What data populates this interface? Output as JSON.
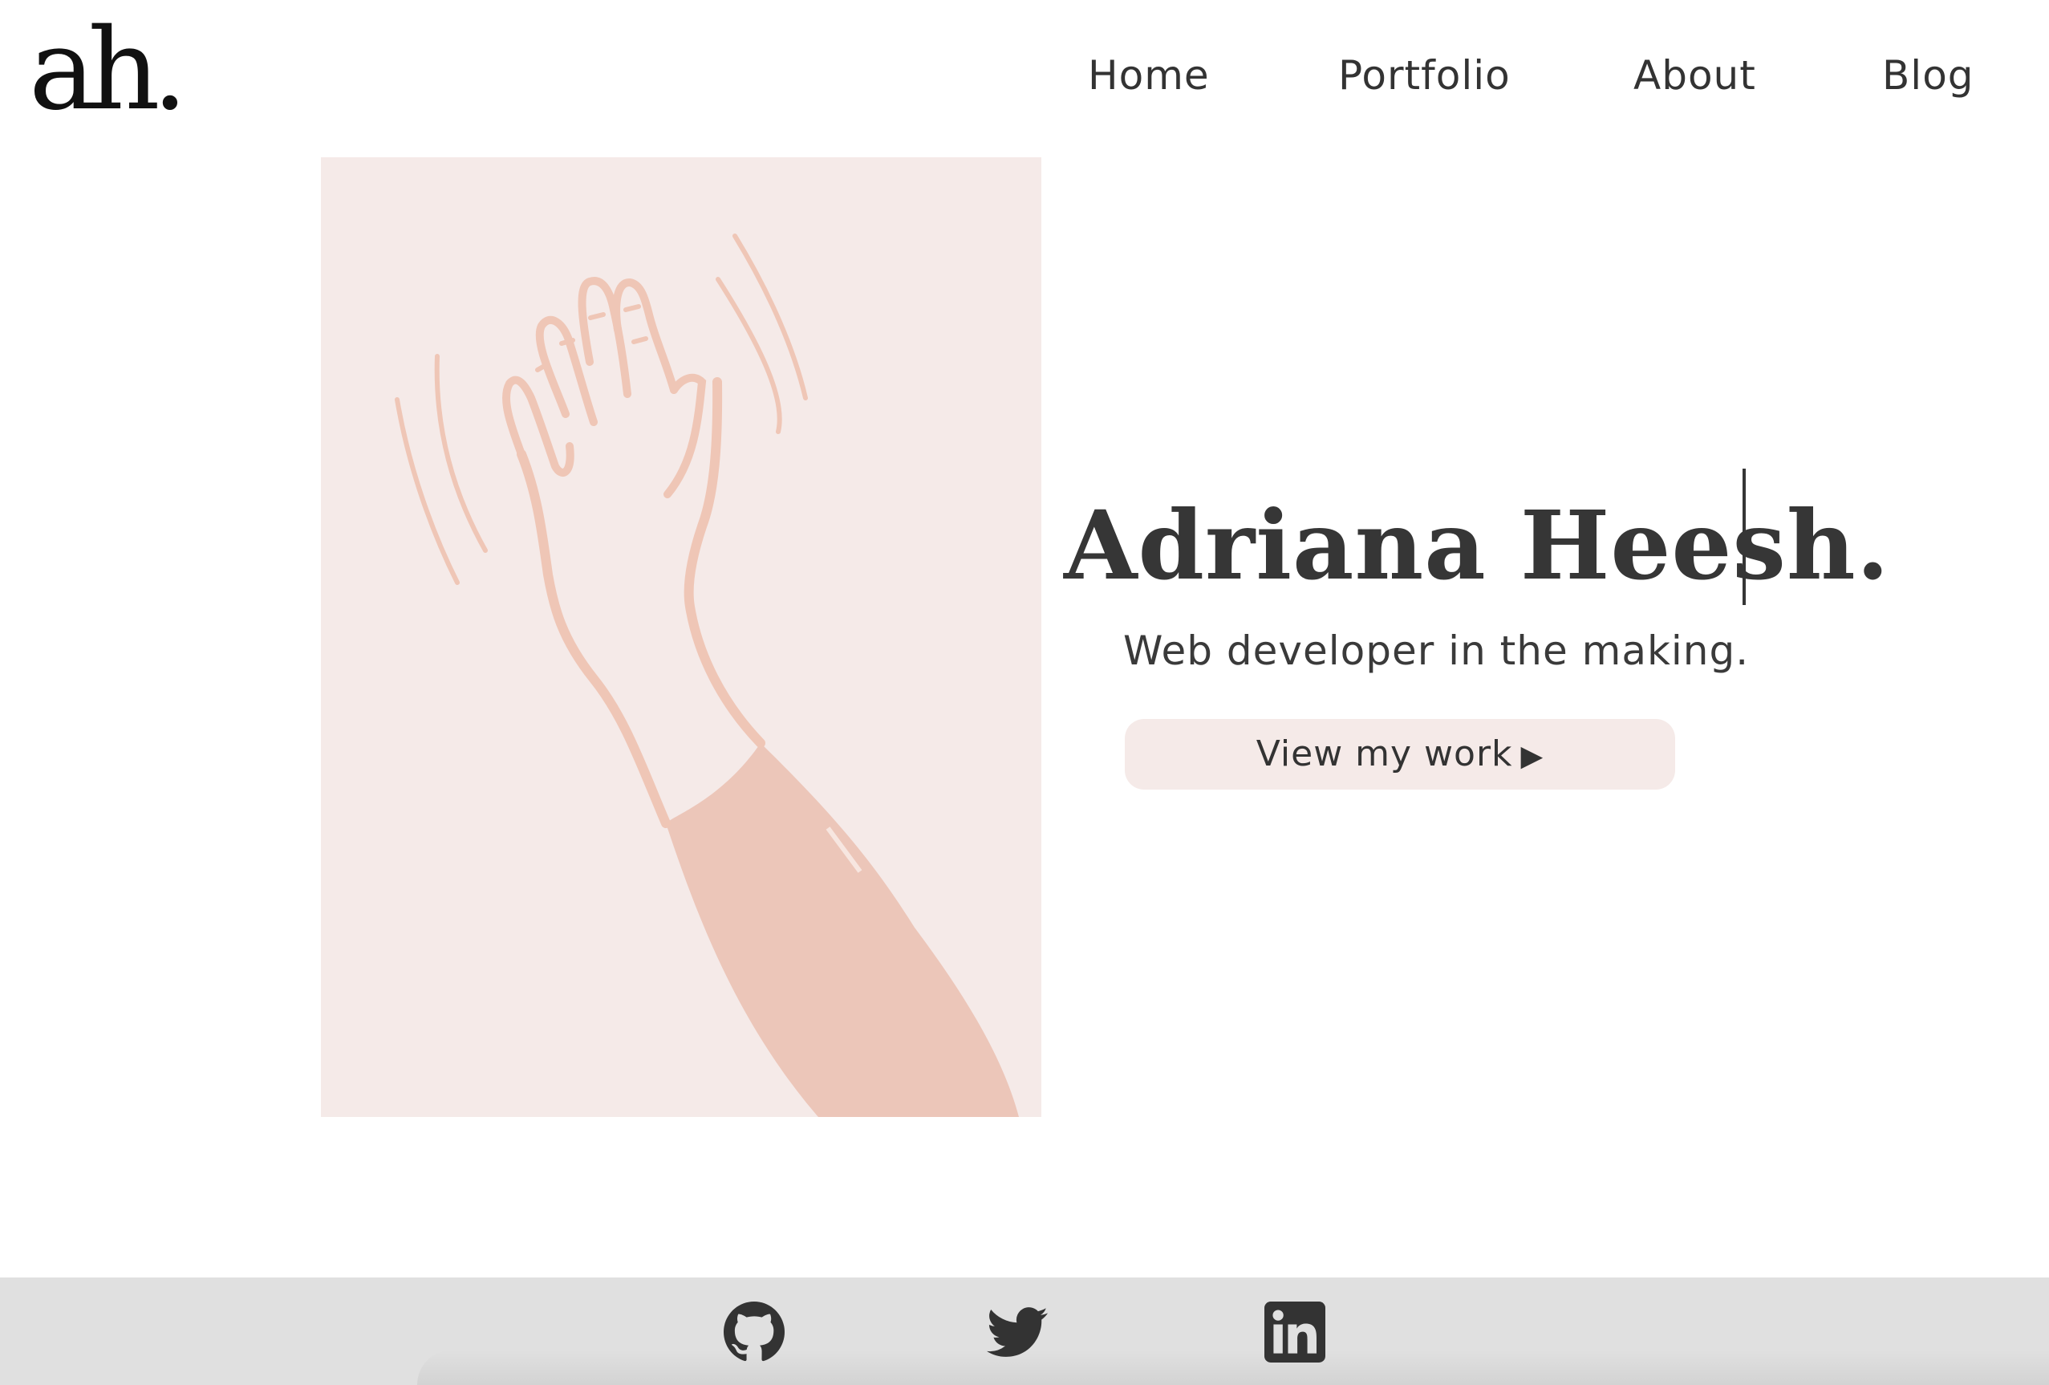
{
  "header": {
    "logo_text": "ah.",
    "nav": [
      {
        "label": "Home"
      },
      {
        "label": "Portfolio"
      },
      {
        "label": "About"
      },
      {
        "label": "Blog"
      }
    ]
  },
  "hero": {
    "name": "Adriana Heesh.",
    "tagline": "Web developer in the making.",
    "cta_label": "View my work",
    "cta_arrow": "▶",
    "illustration": "waving-hand-illustration"
  },
  "footer": {
    "social": [
      {
        "icon": "github-icon"
      },
      {
        "icon": "twitter-icon"
      },
      {
        "icon": "linkedin-icon"
      }
    ]
  },
  "colors": {
    "text": "#333333",
    "accent_bg": "#f5eae8",
    "illustration_line": "#efc6b6",
    "sleeve": "#ecc6b9",
    "footer_bg": "#e0e0e0"
  }
}
